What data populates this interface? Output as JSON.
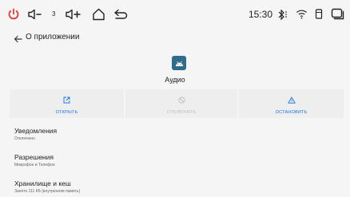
{
  "statusbar": {
    "volume_down_label": "3",
    "time": "15:30"
  },
  "appbar": {
    "title": "О приложении"
  },
  "app": {
    "name": "Аудио"
  },
  "actions": {
    "open": "ОТКРЫТЬ",
    "disable": "ОТКЛЮЧИТЬ",
    "stop": "ОСТАНОВИТЬ"
  },
  "settings": [
    {
      "title": "Уведомления",
      "subtitle": "Отключено"
    },
    {
      "title": "Разрешения",
      "subtitle": "Микрофон и Телефон"
    },
    {
      "title": "Хранилище и кеш",
      "subtitle": "Занято 111 КБ (внутренняя память)"
    }
  ],
  "colors": {
    "accent": "#1a73e8",
    "power": "#e53935",
    "disabled": "#bdbdbd",
    "app_icon_bg": "#2f6b8a"
  }
}
